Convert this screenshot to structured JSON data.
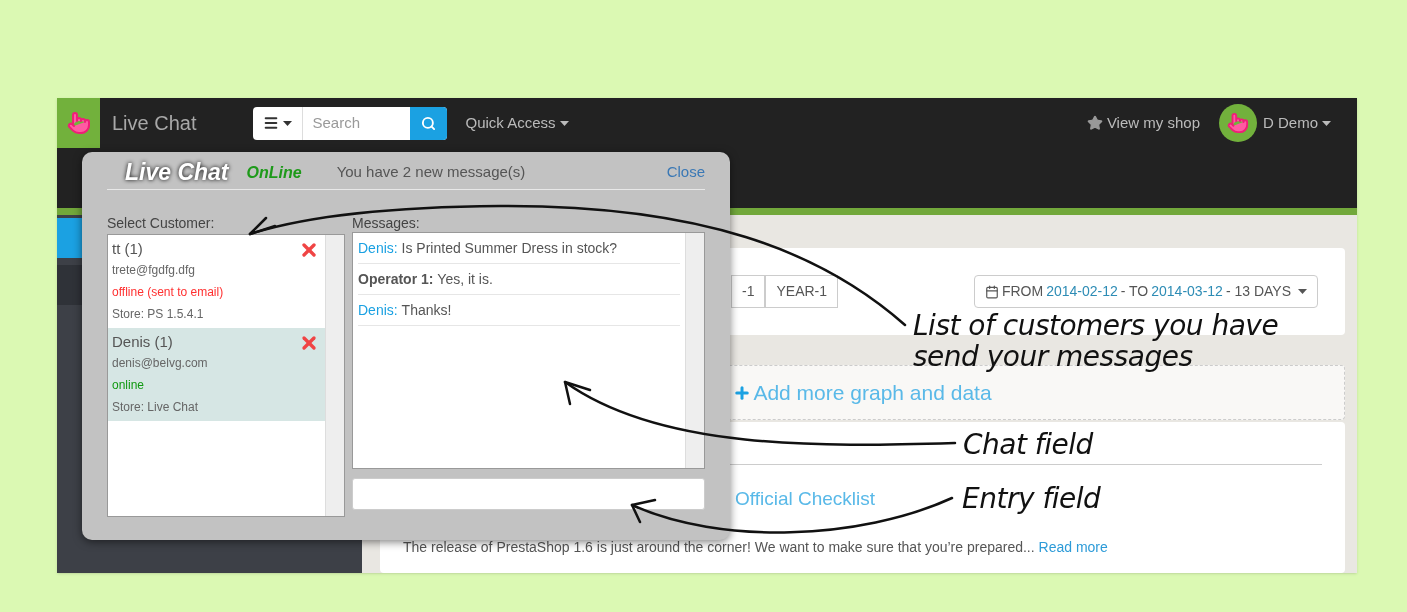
{
  "top_bar": {
    "app_title": "Live Chat",
    "search": {
      "placeholder": "Search"
    },
    "quick_access": "Quick Access",
    "view_shop": "View my shop",
    "user": "D Demo"
  },
  "sidebar": {
    "items": [
      {
        "selected": true
      },
      {
        "selected": false
      }
    ]
  },
  "dashboard": {
    "period_buttons": [
      "-1",
      "YEAR-1"
    ],
    "date_range": {
      "from_label": "FROM",
      "from": "2014-02-12",
      "to_label": "- TO",
      "to": "2014-03-12",
      "days": "- 13 DAYS"
    },
    "add_graph": "Add more graph and data",
    "checklist_link": "Official Checklist",
    "news": {
      "text": "The release of PrestaShop 1.6 is just around the corner! We want to make sure that you’re prepared...",
      "link": "Read more"
    }
  },
  "chat": {
    "title": "Live Chat",
    "status": "OnLine",
    "notice": "You have 2 new message(s)",
    "close": "Close",
    "customers_label": "Select Customer:",
    "messages_label": "Messages:",
    "customers": [
      {
        "name": "tt (1)",
        "email": "trete@fgdfg.dfg",
        "status": "offline (sent to email)",
        "online": false,
        "store": "Store: PS 1.5.4.1",
        "selected": false
      },
      {
        "name": "Denis (1)",
        "email": "denis@belvg.com",
        "status": "online",
        "online": true,
        "store": "Store: Live Chat",
        "selected": true
      }
    ],
    "messages": [
      {
        "author": "Denis:",
        "text": "Is Printed Summer Dress in stock?",
        "kind": "customer"
      },
      {
        "author": "Operator 1:",
        "text": "Yes, it is.",
        "kind": "operator"
      },
      {
        "author": "Denis:",
        "text": "Thanks!",
        "kind": "customer"
      }
    ]
  },
  "annotations": [
    {
      "text": "List of customers you have send your messages"
    },
    {
      "text": "Chat field"
    },
    {
      "text": "Entry field"
    }
  ]
}
